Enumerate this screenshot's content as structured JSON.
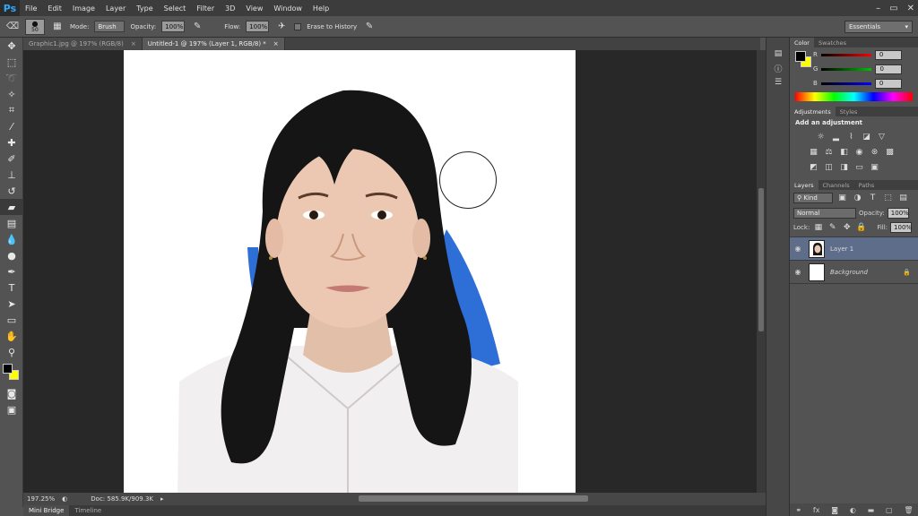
{
  "app": {
    "logo": "Ps"
  },
  "menu": [
    "File",
    "Edit",
    "Image",
    "Layer",
    "Type",
    "Select",
    "Filter",
    "3D",
    "View",
    "Window",
    "Help"
  ],
  "window_controls": [
    "–",
    "▭",
    "✕"
  ],
  "options": {
    "brush_size": "50",
    "mode_label": "Mode:",
    "mode_value": "Brush",
    "opacity_label": "Opacity:",
    "opacity_value": "100%",
    "flow_label": "Flow:",
    "flow_value": "100%",
    "erase_history_label": "Erase to History",
    "workspace": "Essentials"
  },
  "tabs": [
    {
      "label": "Graphic1.jpg @ 197% (RGB/8)",
      "close": "×"
    },
    {
      "label": "Untitled-1 @ 197% (Layer 1, RGB/8) *",
      "close": "×"
    }
  ],
  "status": {
    "zoom": "197.25%",
    "doc": "Doc: 585.9K/909.3K"
  },
  "bottom_tabs": [
    "Mini Bridge",
    "Timeline"
  ],
  "color_panel": {
    "tabs": [
      "Color",
      "Swatches"
    ],
    "channels": [
      {
        "label": "R",
        "value": "0",
        "color": "#ff0000"
      },
      {
        "label": "G",
        "value": "0",
        "color": "#00c000"
      },
      {
        "label": "B",
        "value": "0",
        "color": "#0000ff"
      }
    ],
    "foreground": "#000000",
    "background": "#ffff00"
  },
  "adjustments_panel": {
    "tabs": [
      "Adjustments",
      "Styles"
    ],
    "title": "Add an adjustment"
  },
  "layers_panel": {
    "tabs": [
      "Layers",
      "Channels",
      "Paths"
    ],
    "kind": "Kind",
    "blend_mode": "Normal",
    "opacity_label": "Opacity:",
    "opacity_value": "100%",
    "lock_label": "Lock:",
    "fill_label": "Fill:",
    "fill_value": "100%",
    "layers": [
      {
        "name": "Layer 1",
        "selected": true
      },
      {
        "name": "Background",
        "selected": false
      }
    ],
    "footer_icons": [
      "link-icon",
      "fx-icon",
      "mask-icon",
      "adjustment-icon",
      "folder-icon",
      "new-layer-icon",
      "trash-icon"
    ]
  }
}
